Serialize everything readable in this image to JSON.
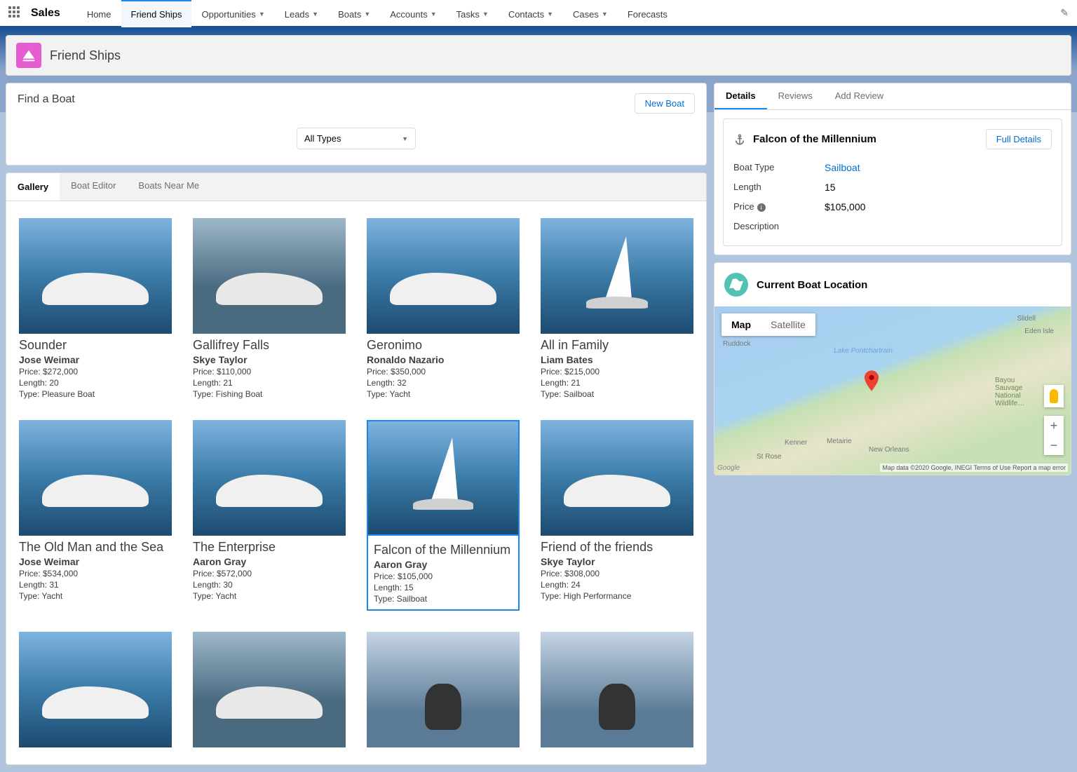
{
  "app_name": "Sales",
  "nav": {
    "items": [
      "Home",
      "Friend Ships",
      "Opportunities",
      "Leads",
      "Boats",
      "Accounts",
      "Tasks",
      "Contacts",
      "Cases",
      "Forecasts"
    ],
    "dropdown_flags": [
      false,
      false,
      true,
      true,
      true,
      true,
      true,
      true,
      true,
      false
    ],
    "active_index": 1
  },
  "page": {
    "title": "Friend Ships"
  },
  "find": {
    "title": "Find a Boat",
    "new_boat_btn": "New Boat",
    "type_filter": "All Types"
  },
  "left_tabs": {
    "items": [
      "Gallery",
      "Boat Editor",
      "Boats Near Me"
    ],
    "active_index": 0
  },
  "boats": [
    {
      "name": "Sounder",
      "owner": "Jose Weimar",
      "price": "$272,000",
      "length": "20",
      "type": "Pleasure Boat",
      "img": "motor",
      "selected": false
    },
    {
      "name": "Gallifrey Falls",
      "owner": "Skye Taylor",
      "price": "$110,000",
      "length": "21",
      "type": "Fishing Boat",
      "img": "fishing",
      "selected": false
    },
    {
      "name": "Geronimo",
      "owner": "Ronaldo Nazario",
      "price": "$350,000",
      "length": "32",
      "type": "Yacht",
      "img": "yacht",
      "selected": false
    },
    {
      "name": "All in Family",
      "owner": "Liam Bates",
      "price": "$215,000",
      "length": "21",
      "type": "Sailboat",
      "img": "sail",
      "selected": false
    },
    {
      "name": "The Old Man and the Sea",
      "owner": "Jose Weimar",
      "price": "$534,000",
      "length": "31",
      "type": "Yacht",
      "img": "yacht",
      "selected": false
    },
    {
      "name": "The Enterprise",
      "owner": "Aaron Gray",
      "price": "$572,000",
      "length": "30",
      "type": "Yacht",
      "img": "yacht",
      "selected": false
    },
    {
      "name": "Falcon of the Millennium",
      "owner": "Aaron Gray",
      "price": "$105,000",
      "length": "15",
      "type": "Sailboat",
      "img": "sail",
      "selected": true
    },
    {
      "name": "Friend of the friends",
      "owner": "Skye Taylor",
      "price": "$308,000",
      "length": "24",
      "type": "High Performance",
      "img": "speed",
      "selected": false
    },
    {
      "name": "",
      "owner": "",
      "price": "",
      "length": "",
      "type": "",
      "img": "yacht",
      "selected": false
    },
    {
      "name": "",
      "owner": "",
      "price": "",
      "length": "",
      "type": "",
      "img": "fishing",
      "selected": false
    },
    {
      "name": "",
      "owner": "",
      "price": "",
      "length": "",
      "type": "",
      "img": "jetski",
      "selected": false
    },
    {
      "name": "",
      "owner": "",
      "price": "",
      "length": "",
      "type": "",
      "img": "jetski",
      "selected": false
    }
  ],
  "right_tabs": {
    "items": [
      "Details",
      "Reviews",
      "Add Review"
    ],
    "active_index": 0
  },
  "detail": {
    "title": "Falcon of the Millennium",
    "full_details_btn": "Full Details",
    "fields": {
      "boat_type_label": "Boat Type",
      "boat_type_value": "Sailboat",
      "length_label": "Length",
      "length_value": "15",
      "price_label": "Price",
      "price_value": "$105,000",
      "description_label": "Description"
    }
  },
  "map_card": {
    "title": "Current Boat Location",
    "map_btn": "Map",
    "satellite_btn": "Satellite",
    "attribution_brand": "Google",
    "attribution_text": "Map data ©2020 Google, INEGI   Terms of Use   Report a map error",
    "labels": [
      "Slidell",
      "Eden Isle",
      "Lake Pontchartrain",
      "New Orleans",
      "Metairie",
      "Kenner",
      "St Rose",
      "Ruddock",
      "Bayou Sauvage National Wildlife…"
    ]
  },
  "labels": {
    "price_prefix": "Price: ",
    "length_prefix": "Length: ",
    "type_prefix": "Type: "
  }
}
